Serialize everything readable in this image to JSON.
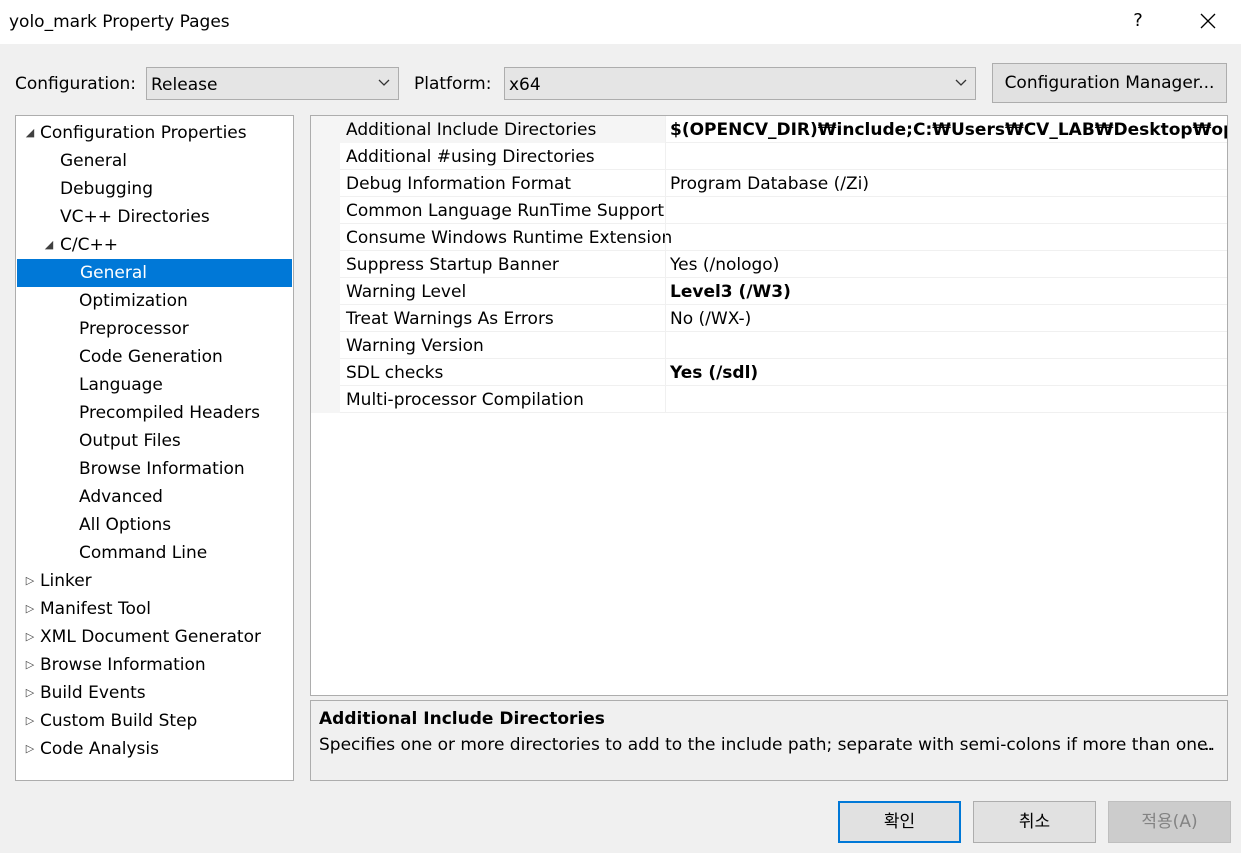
{
  "window": {
    "title": "yolo_mark Property Pages",
    "help": "?",
    "close_icon": "close-icon"
  },
  "config_bar": {
    "configuration_label": "Configuration:",
    "configuration_value": "Release",
    "platform_label": "Platform:",
    "platform_value": "x64",
    "manager_button": "Configuration Manager..."
  },
  "tree": [
    {
      "label": "Configuration Properties",
      "level": 0,
      "expander": "expanded"
    },
    {
      "label": "General",
      "level": 1,
      "expander": "none"
    },
    {
      "label": "Debugging",
      "level": 1,
      "expander": "none"
    },
    {
      "label": "VC++ Directories",
      "level": 1,
      "expander": "none"
    },
    {
      "label": "C/C++",
      "level": 1,
      "expander": "expanded"
    },
    {
      "label": "General",
      "level": 2,
      "expander": "none",
      "selected": true
    },
    {
      "label": "Optimization",
      "level": 2,
      "expander": "none"
    },
    {
      "label": "Preprocessor",
      "level": 2,
      "expander": "none"
    },
    {
      "label": "Code Generation",
      "level": 2,
      "expander": "none"
    },
    {
      "label": "Language",
      "level": 2,
      "expander": "none"
    },
    {
      "label": "Precompiled Headers",
      "level": 2,
      "expander": "none"
    },
    {
      "label": "Output Files",
      "level": 2,
      "expander": "none"
    },
    {
      "label": "Browse Information",
      "level": 2,
      "expander": "none"
    },
    {
      "label": "Advanced",
      "level": 2,
      "expander": "none"
    },
    {
      "label": "All Options",
      "level": 2,
      "expander": "none"
    },
    {
      "label": "Command Line",
      "level": 2,
      "expander": "none"
    },
    {
      "label": "Linker",
      "level": 0,
      "expander": "collapsed"
    },
    {
      "label": "Manifest Tool",
      "level": 0,
      "expander": "collapsed"
    },
    {
      "label": "XML Document Generator",
      "level": 0,
      "expander": "collapsed"
    },
    {
      "label": "Browse Information",
      "level": 0,
      "expander": "collapsed"
    },
    {
      "label": "Build Events",
      "level": 0,
      "expander": "collapsed"
    },
    {
      "label": "Custom Build Step",
      "level": 0,
      "expander": "collapsed"
    },
    {
      "label": "Code Analysis",
      "level": 0,
      "expander": "collapsed"
    }
  ],
  "properties": [
    {
      "name": "Additional Include Directories",
      "value": "$(OPENCV_DIR)₩include;C:₩Users₩CV_LAB₩Desktop₩opencv₩bu",
      "bold": true
    },
    {
      "name": "Additional #using Directories",
      "value": "",
      "bold": false
    },
    {
      "name": "Debug Information Format",
      "value": "Program Database (/Zi)",
      "bold": false
    },
    {
      "name": "Common Language RunTime Support",
      "value": "",
      "bold": false
    },
    {
      "name": "Consume Windows Runtime Extension",
      "value": "",
      "bold": false
    },
    {
      "name": "Suppress Startup Banner",
      "value": "Yes (/nologo)",
      "bold": false
    },
    {
      "name": "Warning Level",
      "value": "Level3 (/W3)",
      "bold": true
    },
    {
      "name": "Treat Warnings As Errors",
      "value": "No (/WX-)",
      "bold": false
    },
    {
      "name": "Warning Version",
      "value": "",
      "bold": false
    },
    {
      "name": "SDL checks",
      "value": "Yes (/sdl)",
      "bold": true
    },
    {
      "name": "Multi-processor Compilation",
      "value": "",
      "bold": false
    }
  ],
  "description": {
    "title": "Additional Include Directories",
    "text": "Specifies one or more directories to add to the include path; separate with semi-colons if more than one.",
    "more": "..."
  },
  "buttons": {
    "ok": "확인",
    "cancel": "취소",
    "apply": "적용(A)"
  }
}
